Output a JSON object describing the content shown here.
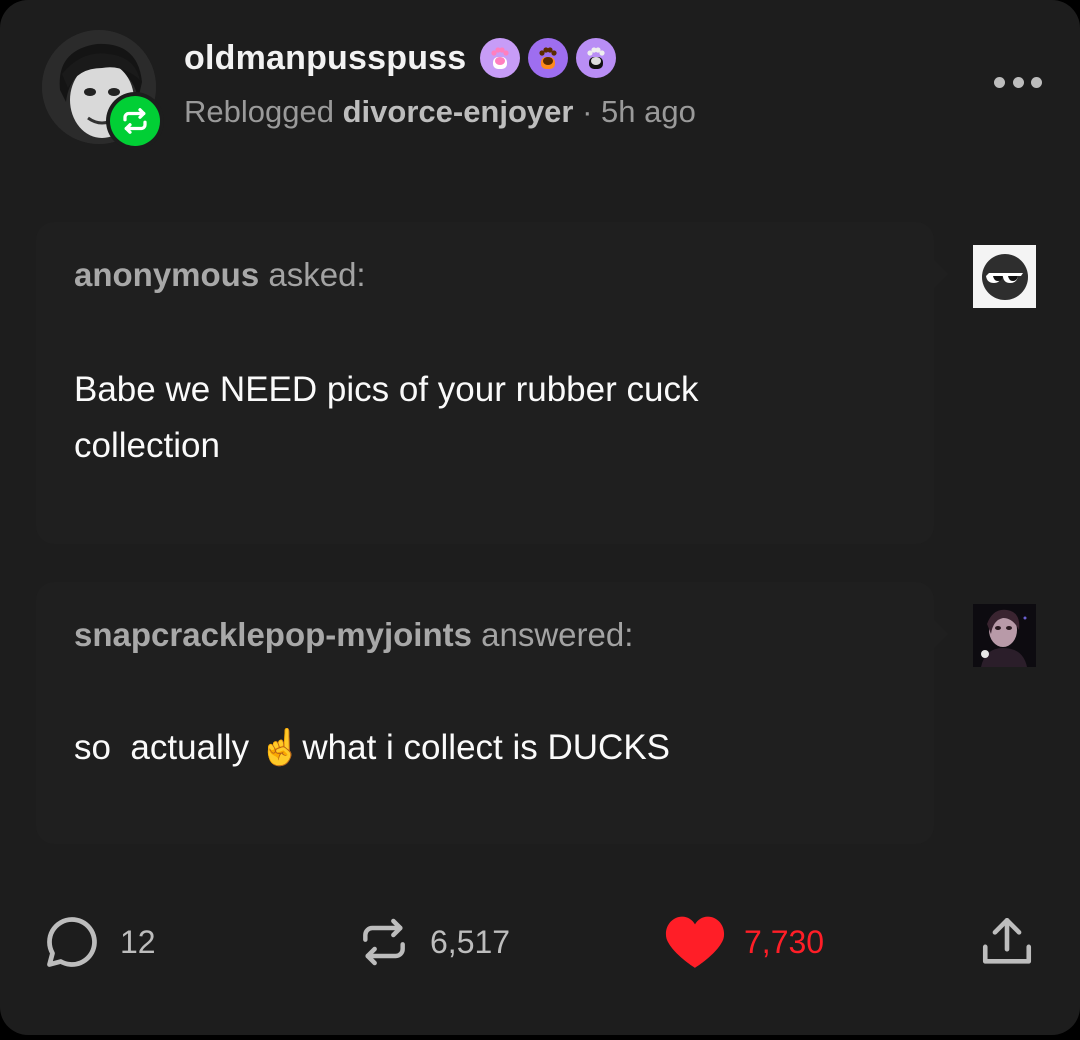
{
  "post": {
    "username": "oldmanpusspuss",
    "reblogged_label": "Reblogged",
    "reblogged_from": "divorce-enjoyer",
    "separator": "·",
    "time_ago": "5h ago"
  },
  "ask": {
    "asker": "anonymous",
    "verb": "asked:",
    "text": "Babe we NEED pics of your rubber cuck collection"
  },
  "answer": {
    "answerer": "snapcracklepop-myjoints",
    "verb": "answered:",
    "text_before": "so  actually ",
    "emoji": "☝️",
    "text_after": "what i collect is DUCKS"
  },
  "footer": {
    "comments": "12",
    "reblogs": "6,517",
    "likes": "7,730"
  },
  "colors": {
    "card": "#1d1d1d",
    "reblog_green": "#01cf35",
    "like_red": "#ff1e27",
    "muted": "#9a9a9a"
  },
  "icons": [
    "reblog-icon",
    "paw-badge-icon",
    "more-icon",
    "comment-icon",
    "like-heart-icon",
    "share-icon",
    "sunglasses-icon"
  ]
}
